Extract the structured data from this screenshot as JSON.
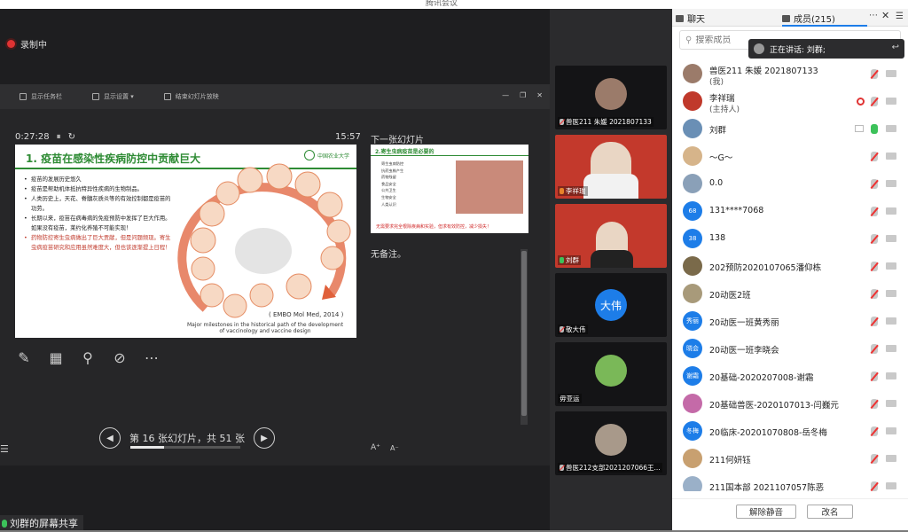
{
  "window": {
    "title": "腾讯会议"
  },
  "recording": {
    "label": "录制中"
  },
  "ppt_toolbar": {
    "show_taskbar": "显示任务栏",
    "display_settings": "显示设置 ▾",
    "end_show": "结束幻灯片放映"
  },
  "presenter": {
    "elapsed": "0:27:28",
    "clock": "15:57",
    "next_slide_label": "下一张幻灯片",
    "notes": "无备注。",
    "page_indicator": "第 16 张幻灯片，共 51 张",
    "progress_fraction": 0.31
  },
  "slide": {
    "title": "1. 疫苗在感染性疾病防控中贡献巨大",
    "logo_text": "中国农业大学",
    "bullets": [
      {
        "text": "疫苗的发展历史悠久",
        "red": false
      },
      {
        "text": "疫苗是帮助机体抵抗特异性疾病的生物制品。",
        "red": false
      },
      {
        "text": "人类历史上，天花、脊髓灰质炎等的有效控制都是疫苗的功劳。",
        "red": false
      },
      {
        "text": "长期以来，疫苗在病毒病的免疫预防中发挥了巨大作用。如果没有疫苗，莱约化养殖不可能实现！",
        "red": false
      },
      {
        "text": "药物防控寄生虫病做出了巨大贡献，但是问题频现。寄生虫病疫苗研究和应用虽然难度大，但也该逐渐提上日程！",
        "red": true
      }
    ],
    "citation": "( EMBO Mol Med, 2014 )",
    "caption": "Major milestones in the historical path of the development of vaccinology and vaccine design"
  },
  "next_slide": {
    "title": "2.寄生虫病疫苗是必要的",
    "list": [
      "寄生虫病防控",
      "抗药虫株产生",
      "药物残留",
      "食品安全",
      "公共卫生",
      "生物安全",
      "人类认识"
    ],
    "footer": "无需要求完全根除疾病和实验，但求有效防控，减少损失！"
  },
  "share_label": "刘群的屏幕共享",
  "video_tiles": [
    {
      "name": "兽医211 朱媛 2021807133",
      "mic": "off"
    },
    {
      "name": "李祥瑞",
      "mic": "user"
    },
    {
      "name": "刘群",
      "mic": "on"
    },
    {
      "name": "敬大伟",
      "mic": "off",
      "avatar_text": "大伟"
    },
    {
      "name": "毋亚运",
      "mic": "none"
    },
    {
      "name": "兽医212支部2021207066王...",
      "mic": "off"
    }
  ],
  "panel": {
    "tab_chat": "聊天",
    "tab_members": "成员(215)",
    "search_placeholder": "搜索成员",
    "speaking": "正在讲话: 刘群;",
    "unmute_all": "解除静音",
    "rename": "改名",
    "members": [
      {
        "name": "兽医211 朱媛 2021807133",
        "sub": "(我)",
        "avatar": "",
        "color": "#9b7b6a",
        "mic": "off"
      },
      {
        "name": "李祥瑞",
        "sub": "(主持人)",
        "avatar": "",
        "color": "#c0392b",
        "mic": "off",
        "rec": true
      },
      {
        "name": "刘群",
        "sub": "",
        "avatar": "",
        "color": "#6a8fb5",
        "mic": "on",
        "screen": true
      },
      {
        "name": "～G～",
        "sub": "",
        "avatar": "",
        "color": "#d6b48a",
        "mic": "off"
      },
      {
        "name": "0.0",
        "sub": "",
        "avatar": "",
        "color": "#8aa0b8",
        "mic": "off"
      },
      {
        "name": "131****7068",
        "sub": "",
        "avatar": "68",
        "color": "#1d7de8",
        "mic": "off"
      },
      {
        "name": "138",
        "sub": "",
        "avatar": "38",
        "color": "#1d7de8",
        "mic": "off"
      },
      {
        "name": "202预防2020107065潘仰栋",
        "sub": "",
        "avatar": "",
        "color": "#7a6a4a",
        "mic": "off"
      },
      {
        "name": "20动医2班",
        "sub": "",
        "avatar": "",
        "color": "#a89a7a",
        "mic": "off"
      },
      {
        "name": "20动医一班黄秀丽",
        "sub": "",
        "avatar": "秀丽",
        "color": "#1d7de8",
        "mic": "off"
      },
      {
        "name": "20动医一班李晓会",
        "sub": "",
        "avatar": "晓会",
        "color": "#1d7de8",
        "mic": "off"
      },
      {
        "name": "20基础-2020207008-谢霜",
        "sub": "",
        "avatar": "谢霜",
        "color": "#1d7de8",
        "mic": "off"
      },
      {
        "name": "20基础兽医-2020107013-闫巍元",
        "sub": "",
        "avatar": "",
        "color": "#c46aa8",
        "mic": "off"
      },
      {
        "name": "20临床-20201070808-岳冬梅",
        "sub": "",
        "avatar": "冬梅",
        "color": "#1d7de8",
        "mic": "off"
      },
      {
        "name": "211何妍钰",
        "sub": "",
        "avatar": "",
        "color": "#c8a070",
        "mic": "off"
      },
      {
        "name": "211国本部 2021107057陈恶",
        "sub": "",
        "avatar": "",
        "color": "#9ab0c8",
        "mic": "off"
      }
    ]
  },
  "colors": {
    "accent": "#1d7de8",
    "mic_on": "#3cc25a",
    "record": "#e03333",
    "slide_green": "#2e8b34"
  }
}
